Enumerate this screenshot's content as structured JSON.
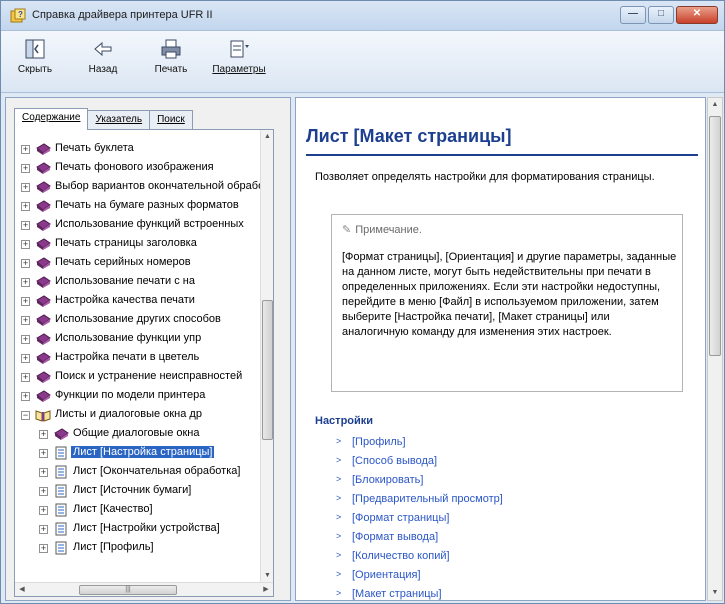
{
  "window": {
    "title": "Справка драйвера принтера UFR II",
    "controls": {
      "minimize": "—",
      "maximize": "□",
      "close": "✕"
    }
  },
  "toolbar": {
    "buttons": [
      {
        "label": "Скрыть",
        "icon": "hide-pane-icon"
      },
      {
        "label": "Назад",
        "icon": "back-arrow-icon"
      },
      {
        "label": "Печать",
        "icon": "printer-icon"
      },
      {
        "label": "Параметры",
        "icon": "options-icon"
      }
    ]
  },
  "nav": {
    "tabs": [
      {
        "label": "Содержание",
        "active": true
      },
      {
        "label": "Указатель",
        "active": false
      },
      {
        "label": "Поиск",
        "active": false
      }
    ],
    "tree": [
      {
        "label": "Печать буклета",
        "level": 0,
        "icon": "book-closed-icon",
        "expander": "+"
      },
      {
        "label": "Печать фонового изображения",
        "level": 0,
        "icon": "book-closed-icon",
        "expander": "+"
      },
      {
        "label": "Выбор вариантов окончательной обработки",
        "level": 0,
        "icon": "book-closed-icon",
        "expander": "+"
      },
      {
        "label": "Печать на бумаге разных форматов",
        "level": 0,
        "icon": "book-closed-icon",
        "expander": "+"
      },
      {
        "label": "Использование функций встроенных",
        "level": 0,
        "icon": "book-closed-icon",
        "expander": "+"
      },
      {
        "label": "Печать страницы заголовка",
        "level": 0,
        "icon": "book-closed-icon",
        "expander": "+"
      },
      {
        "label": "Печать серийных номеров",
        "level": 0,
        "icon": "book-closed-icon",
        "expander": "+"
      },
      {
        "label": "Использование печати с на",
        "level": 0,
        "icon": "book-closed-icon",
        "expander": "+"
      },
      {
        "label": "Настройка качества печати",
        "level": 0,
        "icon": "book-closed-icon",
        "expander": "+"
      },
      {
        "label": "Использование других способов",
        "level": 0,
        "icon": "book-closed-icon",
        "expander": "+"
      },
      {
        "label": "Использование функции упр",
        "level": 0,
        "icon": "book-closed-icon",
        "expander": "+"
      },
      {
        "label": "Настройка печати в цветель",
        "level": 0,
        "icon": "book-closed-icon",
        "expander": "+"
      },
      {
        "label": "Поиск и устранение неисправностей",
        "level": 0,
        "icon": "book-closed-icon",
        "expander": "+"
      },
      {
        "label": "Функции по модели принтера",
        "level": 0,
        "icon": "book-closed-icon",
        "expander": "+"
      },
      {
        "label": "Листы и диалоговые окна др",
        "level": 0,
        "icon": "book-open-icon",
        "expander": "−"
      },
      {
        "label": "Общие диалоговые окна",
        "level": 1,
        "icon": "book-closed-icon",
        "expander": "+"
      },
      {
        "label": "Лист [Настройка страницы]",
        "level": 1,
        "icon": "page-icon",
        "expander": "+",
        "selected": true
      },
      {
        "label": "Лист [Окончательная обработка]",
        "level": 1,
        "icon": "page-icon",
        "expander": "+"
      },
      {
        "label": "Лист [Источник бумаги]",
        "level": 1,
        "icon": "page-icon",
        "expander": "+"
      },
      {
        "label": "Лист [Качество]",
        "level": 1,
        "icon": "page-icon",
        "expander": "+"
      },
      {
        "label": "Лист [Настройки устройства]",
        "level": 1,
        "icon": "page-icon",
        "expander": "+"
      },
      {
        "label": "Лист [Профиль]",
        "level": 1,
        "icon": "page-icon",
        "expander": "+"
      }
    ]
  },
  "content": {
    "title": "Лист [Макет страницы]",
    "intro": "Позволяет определять настройки для форматирования страницы.",
    "note": {
      "heading": "Примечание.",
      "body": "[Формат страницы], [Ориентация] и другие параметры, заданные на данном листе, могут быть недействительны при печати в определенных приложениях. Если эти настройки недоступны, перейдите в меню [Файл] в используемом приложении, затем выберите [Настройка печати], [Макет страницы] или аналогичную команду для изменения этих настроек."
    },
    "settings_heading": "Настройки",
    "links": [
      "[Профиль]",
      "[Способ вывода]",
      "[Блокировать]",
      "[Предварительный просмотр]",
      "[Формат страницы]",
      "[Формат вывода]",
      "[Количество копий]",
      "[Ориентация]",
      "[Макет страницы]"
    ]
  },
  "colors": {
    "heading": "#1d3f8f",
    "link": "#2a56c6",
    "selection": "#2b65c4",
    "book": "#8b3a8b"
  }
}
